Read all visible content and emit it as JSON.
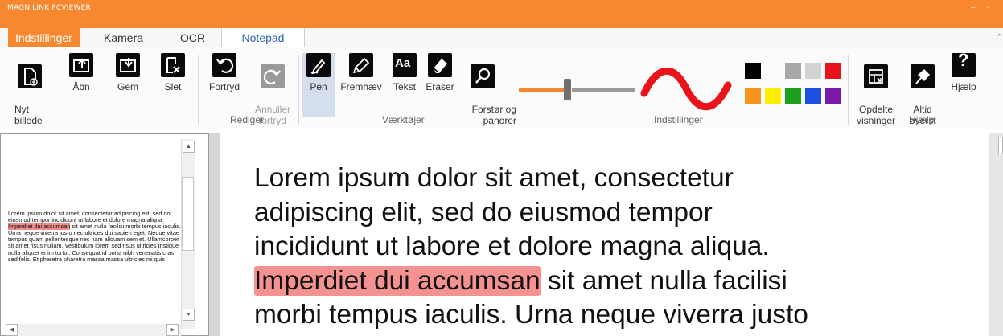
{
  "app": {
    "title": "MAGNILINK PCVIEWER"
  },
  "tabs": [
    {
      "label": "Indstillinger"
    },
    {
      "label": "Kamera"
    },
    {
      "label": "OCR"
    },
    {
      "label": "Notepad"
    }
  ],
  "ribbon": {
    "file_buttons": {
      "new": "Nyt\nbillede",
      "open": "Åbn",
      "save": "Gem",
      "delete": "Slet"
    },
    "edit": {
      "undo": "Fortryd",
      "redo": "Annuller\nfortryd",
      "group_label": "Rediger"
    },
    "tools": {
      "pen": "Pen",
      "highlight": "Fremhæv",
      "text": "Tekst",
      "eraser": "Eraser",
      "zoom": "Forstør og\npanorer",
      "group_label": "Værktøjer",
      "text_icon": "Aa"
    },
    "settings": {
      "group_label": "Indstillinger",
      "pen_color": "#e8141a",
      "slider_color": "#f7882f",
      "colors": [
        "#000000",
        "#a8a8a8",
        "#d3d3d3",
        "#e8141a",
        "#f7941d",
        "#ffee00",
        "#1aa01a",
        "#1e4fe0",
        "#7a1aa8"
      ]
    },
    "help": {
      "split": "Opdelte\nvisninger",
      "ontop": "Altid\nøverst",
      "help": "Hjælp",
      "group_label": "Hjælp"
    }
  },
  "thumbnail": {
    "before_highlight": "Lorem ipsum dolor sit amet, consectetur adipiscing elit, sed do eiusmod tempor incididunt ut labore et dolore magna aliqua. ",
    "highlight": "Imperdiet dui accumsan",
    "after_highlight": " sit amet nulla facilisi morbi tempus iaculis. Urna neque viverra justo nec ultrices dui sapien eget. Neque vitae tempus quam pellentesque nec nam aliquam sem et. Ullamcorper sit amet risus nullam. Vestibulum lorem sed risus ultricies tristique nulla aliquet enim tortor. Consequat id porta nibh venenatis cras sed felis. Et pharetra pharetra massa massa ultricies mi quis"
  },
  "document": {
    "line1": "Lorem ipsum dolor sit amet, consectetur",
    "line2": "adipiscing elit, sed do eiusmod tempor",
    "line3": "incididunt ut labore et dolore magna aliqua.",
    "highlight": "Imperdiet dui accumsan",
    "line4_rest": " sit amet nulla facilisi",
    "line5": "morbi tempus iaculis. Urna neque viverra justo"
  }
}
